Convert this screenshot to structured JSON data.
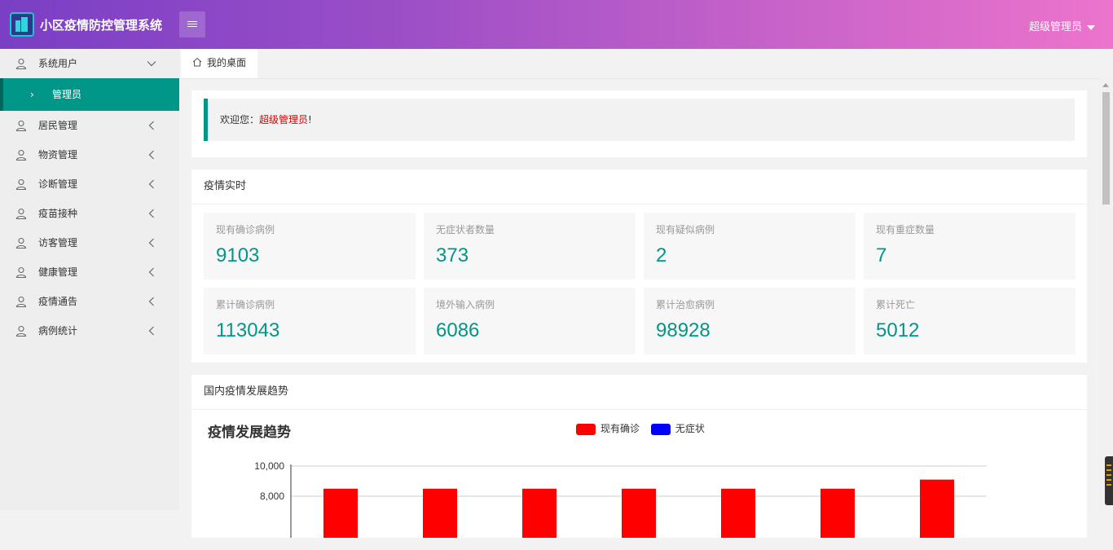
{
  "header": {
    "title": "小区疫情防控管理系统",
    "user": "超级管理员"
  },
  "sidebar": {
    "group": {
      "label": "系统用户",
      "expanded": true,
      "sub_label": "管理员"
    },
    "items": [
      {
        "label": "居民管理"
      },
      {
        "label": "物资管理"
      },
      {
        "label": "诊断管理"
      },
      {
        "label": "疫苗接种"
      },
      {
        "label": "访客管理"
      },
      {
        "label": "健康管理"
      },
      {
        "label": "疫情通告"
      },
      {
        "label": "病例统计"
      }
    ]
  },
  "tabs": [
    {
      "label": "我的桌面",
      "icon": "home-icon"
    }
  ],
  "welcome": {
    "prefix": "欢迎您：",
    "name": "超级管理员",
    "suffix": "!"
  },
  "realtime": {
    "title": "疫情实时",
    "stats": [
      {
        "label": "现有确诊病例",
        "value": "9103"
      },
      {
        "label": "无症状者数量",
        "value": "373"
      },
      {
        "label": "现有疑似病例",
        "value": "2"
      },
      {
        "label": "现有重症数量",
        "value": "7"
      },
      {
        "label": "累计确诊病例",
        "value": "113043"
      },
      {
        "label": "境外输入病例",
        "value": "6086"
      },
      {
        "label": "累计治愈病例",
        "value": "98928"
      },
      {
        "label": "累计死亡",
        "value": "5012"
      }
    ]
  },
  "trend": {
    "title": "国内疫情发展趋势"
  },
  "chart_data": {
    "type": "bar",
    "title": "疫情发展趋势",
    "series": [
      {
        "name": "现有确诊",
        "color": "#ff0000",
        "values": [
          8500,
          8500,
          8500,
          8500,
          8500,
          8500,
          9103
        ]
      },
      {
        "name": "无症状",
        "color": "#0000ff",
        "values": []
      }
    ],
    "y_ticks": [
      "10,000",
      "8,000"
    ],
    "ylim_visible": [
      8000,
      10000
    ],
    "grid": true,
    "legend_position": "top-center"
  },
  "colors": {
    "accent": "#009688",
    "header_start": "#7a3fc5",
    "header_end": "#ec74cc"
  }
}
